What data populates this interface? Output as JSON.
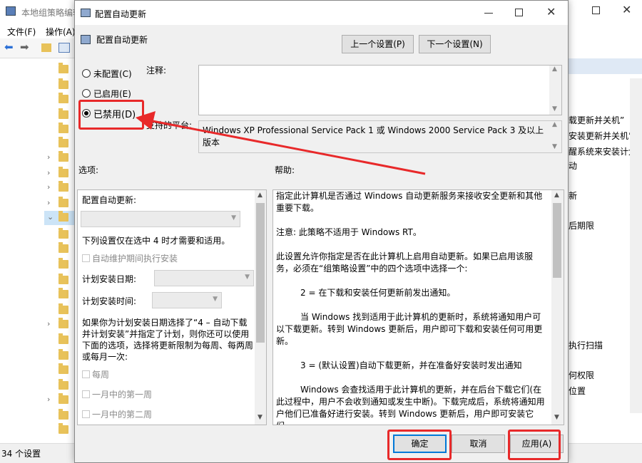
{
  "bg_window": {
    "title": "本地组策略编辑",
    "menu": [
      "文件(F)",
      "操作(A)"
    ],
    "status": "34 个设置",
    "right_items": [
      "载更新并关机”",
      "安装更新并关机”的",
      "醒系统来安装计划",
      "动",
      "新",
      "后期限",
      "执行扫描",
      "何权限",
      "位置"
    ]
  },
  "dialog": {
    "title": "配置自动更新",
    "setting_name": "配置自动更新",
    "prev_button": "上一个设置(P)",
    "next_button": "下一个设置(N)",
    "radio_not_configured": "未配置(C)",
    "radio_enabled": "已启用(E)",
    "radio_disabled": "已禁用(D)",
    "comment_label": "注释:",
    "platform_label": "支持的平台:",
    "platform_text": "Windows XP Professional Service Pack 1 或 Windows 2000 Service Pack 3 及以上版本",
    "options_label": "选项:",
    "help_label": "帮助:",
    "options": {
      "configure_label": "配置自动更新:",
      "note": "下列设置仅在选中 4 时才需要和适用。",
      "maintenance_checkbox": "自动维护期间执行安装",
      "install_day_label": "计划安装日期:",
      "install_time_label": "计划安装时间:",
      "paragraph": "如果你为计划安装日期选择了“4 – 自动下载并计划安装”并指定了计划，则你还可以使用下面的选项，选择将更新限制为每周、每两周或每月一次:",
      "every_week": "每周",
      "first_week": "一月中的第一周",
      "second_week": "一月中的第二周"
    },
    "help_paragraphs": [
      "指定此计算机是否通过 Windows 自动更新服务来接收安全更新和其他重要下载。",
      "注意: 此策略不适用于 Windows RT。",
      "此设置允许你指定是否在此计算机上启用自动更新。如果已启用该服务，必须在“组策略设置”中的四个选项中选择一个:",
      "2 = 在下载和安装任何更新前发出通知。",
      "当 Windows 找到适用于此计算机的更新时，系统将通知用户可以下载更新。转到 Windows 更新后，用户即可下载和安装任何可用更新。",
      "3 = (默认设置)自动下载更新，并在准备好安装时发出通知",
      "Windows 会查找适用于此计算机的更新，并在后台下载它们(在此过程中，用户不会收到通知或发生中断)。下载完成后，系统将通知用户他们已准备好进行安装。转到 Windows 更新后，用户即可安装它们。"
    ],
    "ok_button": "确定",
    "cancel_button": "取消",
    "apply_button": "应用(A)"
  },
  "colors": {
    "annotation": "#e8292a",
    "dialog_bg": "#f0f0f0",
    "folder": "#e8c25a",
    "accent": "#0078d7"
  }
}
